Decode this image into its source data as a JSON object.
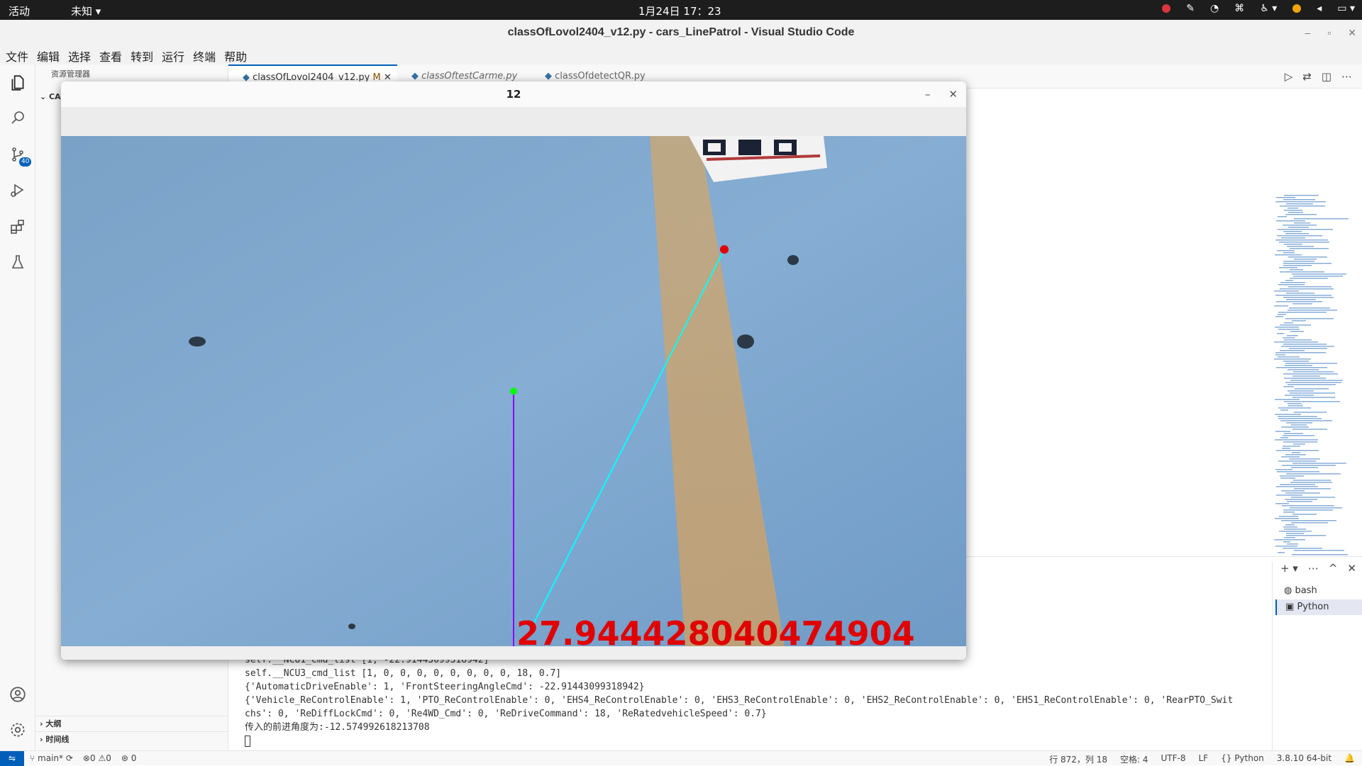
{
  "topbar": {
    "activities": "活动",
    "app_menu": "未知",
    "clock": "1月24日 17：23"
  },
  "window": {
    "title": "classOfLovol2404_v12.py - cars_LinePatrol - Visual Studio Code"
  },
  "menu": [
    "文件",
    "编辑",
    "选择",
    "查看",
    "转到",
    "运行",
    "终端",
    "帮助"
  ],
  "activity_bar": {
    "scm_badge": "40"
  },
  "sidebar": {
    "header": "资源管理器",
    "folder_label": "CA",
    "outline": "大纲",
    "timeline": "时间线"
  },
  "tabs": [
    {
      "label": "classOfLovol2404_v12.py",
      "status": "M"
    },
    {
      "label": "classOftestCarme.py"
    },
    {
      "label": "classOfdetectQR.py"
    }
  ],
  "cv_window": {
    "title": "12",
    "overlay_value": "27.944428040474904"
  },
  "terminal": {
    "lines": [
      "self.__NCU1_cmd_list [1, -22.91443099318942]",
      "self.__NCU3_cmd_list [1, 0, 0, 0, 0, 0, 0, 0, 0, 18, 0.7]",
      "{'AutomaticDriveEnable': 1, 'FrontSteeringAngleCmd': -22.91443099318942}",
      "{'Vehicle_ReControlEnable': 1, 'PTO_ReControlEnable': 0, 'EHS4_ReControlEnable': 0, 'EHS3_ReControlEnable': 0, 'EHS2_ReControlEnable': 0, 'EHS1_ReControlEnable': 0, 'RearPTO_Swit",
      "chs': 0, 'ReDiffLockCmd': 0, 'Re4WD_Cmd': 0, 'ReDriveCommand': 18, 'ReRatedvehicleSpeed': 0.7}",
      "传入的前进角度为:-12.574992618213708"
    ]
  },
  "terminal_list": [
    "bash",
    "Python"
  ],
  "statusbar": {
    "branch": "main*",
    "errors": "0",
    "warnings": "0",
    "ports": "0",
    "position": "行 872，列 18",
    "spaces": "空格: 4",
    "encoding": "UTF-8",
    "eol": "LF",
    "language": "Python",
    "interpreter": "3.8.10 64-bit"
  },
  "colors": {
    "accent": "#005fb8",
    "tray_red": "#d9363e",
    "tray_orange": "#f0a30a",
    "overlay_text": "#e00000",
    "trace_line": "#00ffff",
    "center_line": "#8a00ff",
    "center_point": "#00ff00"
  },
  "icons": [
    "explorer-icon",
    "search-icon",
    "source-control-icon",
    "run-debug-icon",
    "extensions-icon",
    "testing-icon",
    "account-icon",
    "settings-icon"
  ]
}
